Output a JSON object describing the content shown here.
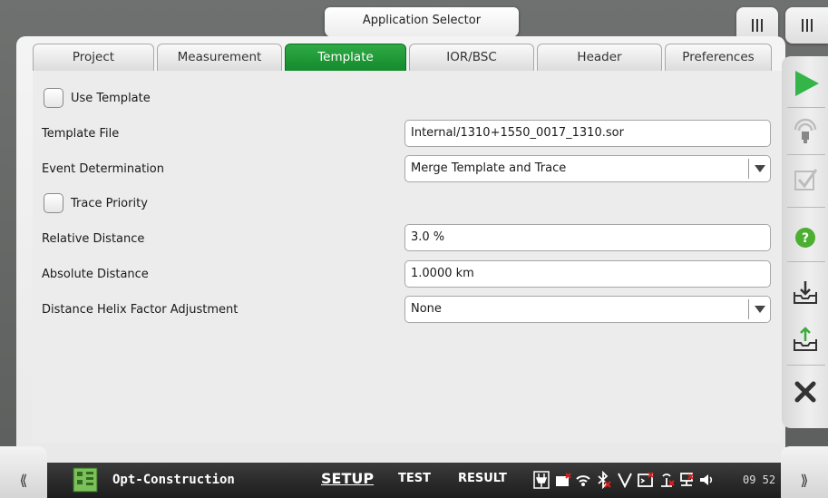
{
  "app_selector": {
    "label": "Application Selector"
  },
  "tabs": [
    {
      "label": "Project"
    },
    {
      "label": "Measurement"
    },
    {
      "label": "Template"
    },
    {
      "label": "IOR/BSC"
    },
    {
      "label": "Header"
    },
    {
      "label": "Preferences"
    }
  ],
  "active_tab": "Template",
  "form": {
    "use_template": {
      "label": "Use Template",
      "checked": false
    },
    "template_file": {
      "label": "Template File",
      "value": "Internal/1310+1550_0017_1310.sor"
    },
    "event_determination": {
      "label": "Event Determination",
      "value": "Merge Template and Trace"
    },
    "trace_priority": {
      "label": "Trace Priority",
      "checked": false
    },
    "relative_distance": {
      "label": "Relative Distance",
      "value": "3.0 %"
    },
    "absolute_distance": {
      "label": "Absolute Distance",
      "value": "1.0000 km"
    },
    "helix_factor": {
      "label": "Distance Helix Factor Adjustment",
      "value": "None"
    }
  },
  "right_toolbar": [
    {
      "icon": "play-icon"
    },
    {
      "icon": "laser-icon"
    },
    {
      "icon": "checkmark-icon"
    },
    {
      "icon": "help-icon"
    },
    {
      "icon": "save-icon"
    },
    {
      "icon": "load-icon"
    },
    {
      "icon": "close-icon"
    }
  ],
  "bottom": {
    "left_btn": "⟪",
    "right_btn": "⟫",
    "app_name": "Opt-Construction",
    "nav": {
      "setup": "SETUP",
      "test": "TEST",
      "result": "RESULT"
    },
    "active_nav": "SETUP",
    "clock": "09 52"
  },
  "colors": {
    "active_tab": "#1a9434",
    "play": "#33b54a",
    "help": "#4caf32"
  }
}
